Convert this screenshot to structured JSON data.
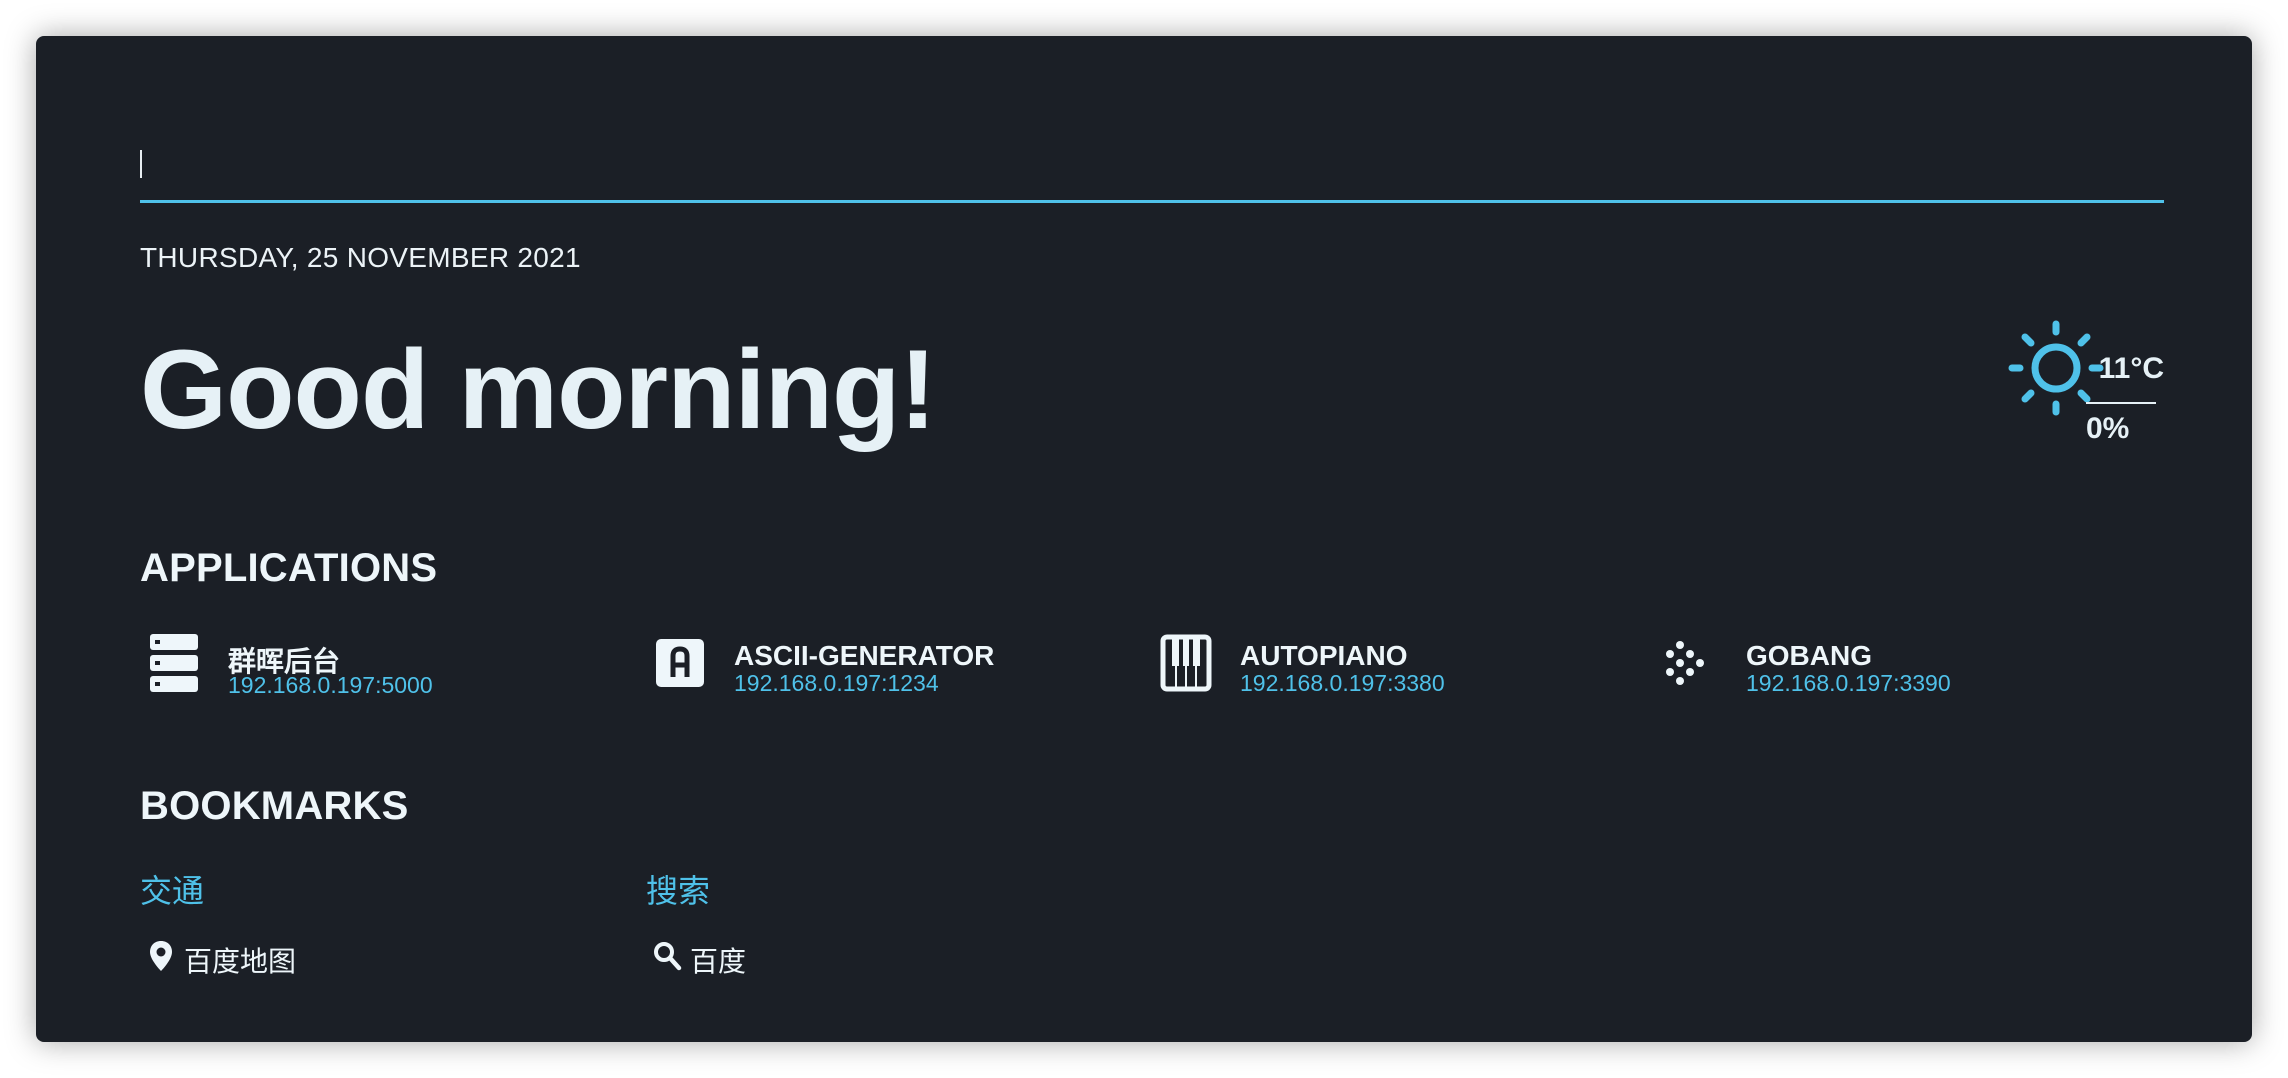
{
  "search": {
    "value": "",
    "placeholder": ""
  },
  "date": "THURSDAY, 25 NOVEMBER 2021",
  "greeting": "Good morning!",
  "weather": {
    "icon": "sun-icon",
    "temperature": "11°C",
    "precipitation": "0%"
  },
  "applications": {
    "title": "APPLICATIONS",
    "items": [
      {
        "name": "群晖后台",
        "url": "192.168.0.197:5000",
        "icon": "server-icon"
      },
      {
        "name": "ASCII-GENERATOR",
        "url": "192.168.0.197:1234",
        "icon": "letter-a-box-icon"
      },
      {
        "name": "AUTOPIANO",
        "url": "192.168.0.197:3380",
        "icon": "piano-icon"
      },
      {
        "name": "GOBANG",
        "url": "192.168.0.197:3390",
        "icon": "dots-grid-icon"
      }
    ]
  },
  "bookmarks": {
    "title": "BOOKMARKS",
    "groups": [
      {
        "title": "交通",
        "links": [
          {
            "label": "百度地图",
            "icon": "map-marker-icon"
          }
        ]
      },
      {
        "title": "搜索",
        "links": [
          {
            "label": "百度",
            "icon": "magnify-icon"
          }
        ]
      }
    ]
  },
  "colors": {
    "background": "#1b1f26",
    "accent": "#4fc1e9",
    "text": "#eef6fa"
  }
}
